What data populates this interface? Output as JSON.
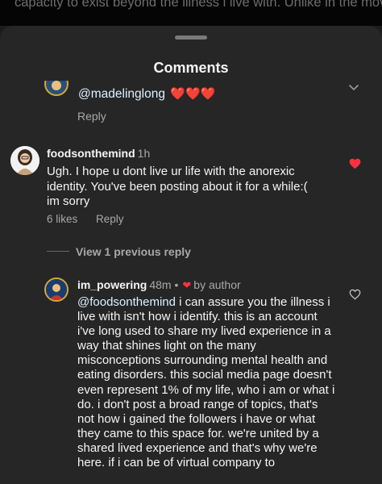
{
  "background_text": "capacity to exist beyond the illness i live with. Unlike in the movies, having an eating disorder doesn't always make you",
  "sheet": {
    "title": "Comments"
  },
  "comment_top": {
    "mention": "@madelinglong",
    "emojis": "❤️❤️❤️",
    "reply_label": "Reply"
  },
  "comment_main": {
    "username": "foodsonthemind",
    "time": "1h",
    "text": "Ugh. I hope u dont live ur life with the anorexic identity. You've been posting about it for a while:(\nim sorry",
    "likes": "6 likes",
    "reply_label": "Reply",
    "liked": true,
    "heart_color": "#ff3040"
  },
  "view_previous": "View 1 previous reply",
  "reply": {
    "username": "im_powering",
    "time": "48m",
    "author_badge": "by author",
    "mention": "@foodsonthemind",
    "text": " i can assure you the illness i live with isn't how i identify. this is an account i've long used to share my lived experience in a way that shines light on the many misconceptions surrounding mental health and eating disorders. this social media page doesn't even represent 1% of my life, who i am or what i do. i don't post a broad range of topics, that's not how i gained the followers i have or what they came to this space for. we're united by a shared lived experience and that's why we're here. if i can be of virtual company to"
  }
}
